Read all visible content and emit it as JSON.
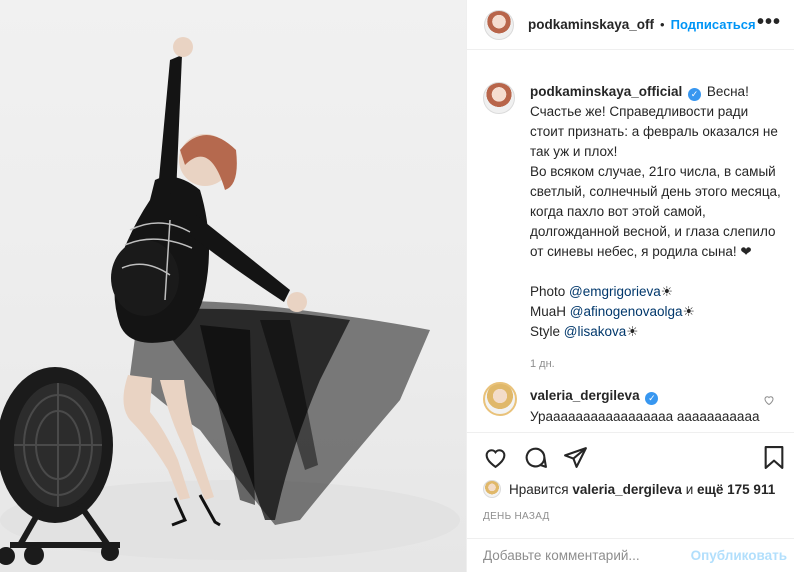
{
  "post": {
    "photo_alt": "",
    "header": {
      "username": "podkaminskaya_off",
      "separator": "•",
      "follow_label": "Подписаться",
      "more_label": "•••"
    },
    "caption": {
      "username": "podkaminskaya_official",
      "verified_mark": "✓",
      "text": "Весна!\nСчастье же! Справедливости ради стоит признать: а февраль оказался не так уж и плох!\nВо всяком случае, 21го числа, в самый светлый, солнечный день этого месяца, когда пахло вот этой самой, долгожданной весной, и глаза слепило от синевы небес, я родила сына! ❤",
      "credits": [
        {
          "label": "Photo ",
          "mention": "@emgrigorieva",
          "suffix": "☀"
        },
        {
          "label": "MuaH ",
          "mention": "@afinogenovaolga",
          "suffix": "☀"
        },
        {
          "label": "Style ",
          "mention": "@lisakova",
          "suffix": "☀"
        }
      ],
      "time_ago": "1 дн."
    },
    "comment": {
      "username": "valeria_dergileva",
      "verified_mark": "✓",
      "text": "Урааааааааааааааааа ааааааааааааааааа"
    },
    "likes": {
      "prefix": "Нравится",
      "user": "valeria_dergileva",
      "middle": "и",
      "others": "ещё 175 911"
    },
    "date_label": "ДЕНЬ НАЗАД",
    "add_comment": {
      "placeholder": "Добавьте комментарий...",
      "publish_label": "Опубликовать"
    },
    "colors": {
      "accent": "#0095f6",
      "verified": "#3897f0",
      "mention": "#00376b",
      "muted": "#8e8e8e",
      "publish_disabled": "#b2dffc"
    }
  }
}
